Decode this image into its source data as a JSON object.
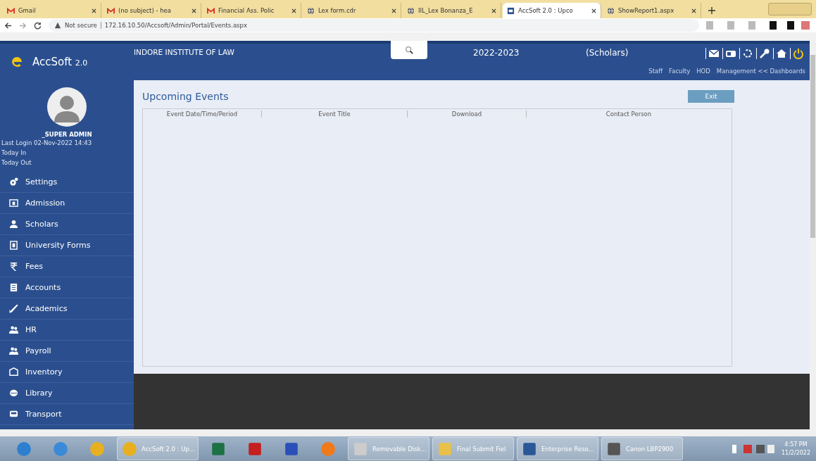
{
  "browser": {
    "tabs": [
      {
        "title": "Gmail",
        "selected": false
      },
      {
        "title": "(no subject) - hea",
        "selected": false
      },
      {
        "title": "Financial Ass. Polic",
        "selected": false
      },
      {
        "title": "Lex form.cdr",
        "selected": false
      },
      {
        "title": "IIL_Lex Bonanza_E",
        "selected": false
      },
      {
        "title": "AccSoft 2.0 : Upco",
        "selected": true
      },
      {
        "title": "ShowReport1.aspx",
        "selected": false
      }
    ],
    "security": "Not secure",
    "url": "172.16.10.50/Accsoft/Admin/Portal/Events.aspx"
  },
  "app": {
    "logo": "AccSoft",
    "version": "2.0",
    "institute": "INDORE INSTITUTE OF LAW",
    "session": "2022-2023",
    "role": "(Scholars)",
    "dashboard_links": [
      "Staff",
      "Faculty",
      "HOD",
      "Management << Dashboards"
    ],
    "user": {
      "name": "_SUPER ADMIN",
      "last_login": "Last Login  02-Nov-2022 14:43",
      "today_in": "Today In",
      "today_out": "Today Out"
    },
    "menu": [
      "Settings",
      "Admission",
      "Scholars",
      "University Forms",
      "Fees",
      "Accounts",
      "Academics",
      "HR",
      "Payroll",
      "Inventory",
      "Library",
      "Transport"
    ],
    "page_title": "Upcoming Events",
    "exit_button": "Exit",
    "table": {
      "columns": [
        "Event Date/Time/Period",
        "Event Title",
        "Download",
        "Contact Person"
      ]
    }
  },
  "taskbar": {
    "windows": [
      "AccSoft 2.0 : Up...",
      "Removable Disk...",
      "Final Submit Fiel",
      "Enterprise Reso...",
      "Canon LBP2900"
    ],
    "time": "4:57 PM",
    "date": "11/2/2022"
  }
}
